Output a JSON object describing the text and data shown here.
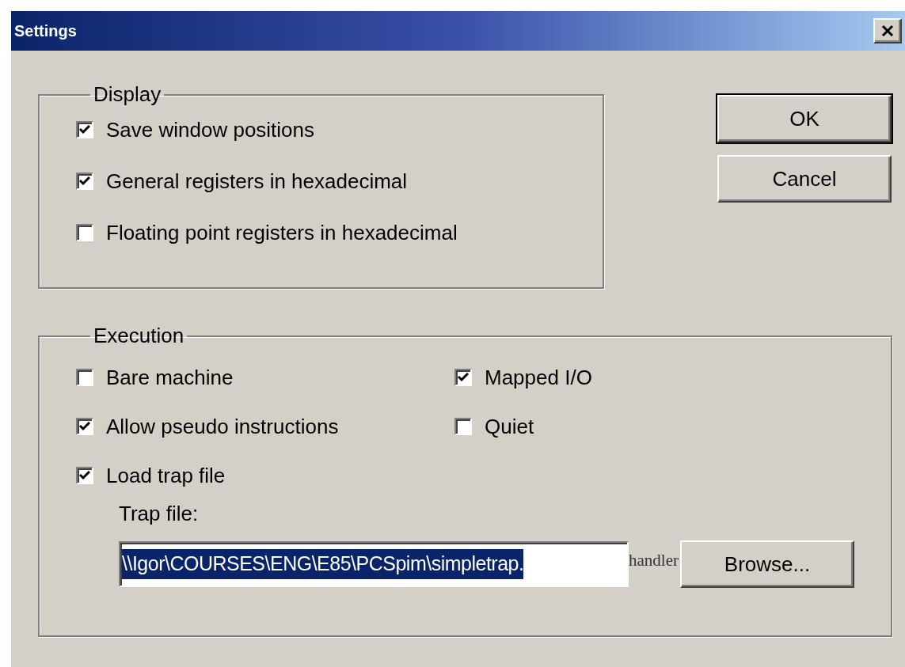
{
  "window": {
    "title": "Settings"
  },
  "display": {
    "legend": "Display",
    "options": [
      {
        "label": "Save window positions",
        "checked": true
      },
      {
        "label": "General registers in hexadecimal",
        "checked": true
      },
      {
        "label": "Floating point registers in hexadecimal",
        "checked": false
      }
    ]
  },
  "buttons": [
    {
      "label": "OK",
      "default": true
    },
    {
      "label": "Cancel",
      "default": false
    }
  ],
  "execution": {
    "legend": "Execution",
    "left_options": [
      {
        "label": "Bare machine",
        "checked": false
      },
      {
        "label": "Allow pseudo instructions",
        "checked": true
      },
      {
        "label": "Load trap file",
        "checked": true
      }
    ],
    "right_options": [
      {
        "label": "Mapped I/O",
        "checked": true
      },
      {
        "label": "Quiet",
        "checked": false
      }
    ],
    "trap_file": {
      "label": "Trap file:",
      "value": "\\\\Igor\\COURSES\\ENG\\E85\\PCSpim\\simpletrap.",
      "selected": true,
      "overflow_text": "handler"
    },
    "browse_button": "Browse..."
  }
}
